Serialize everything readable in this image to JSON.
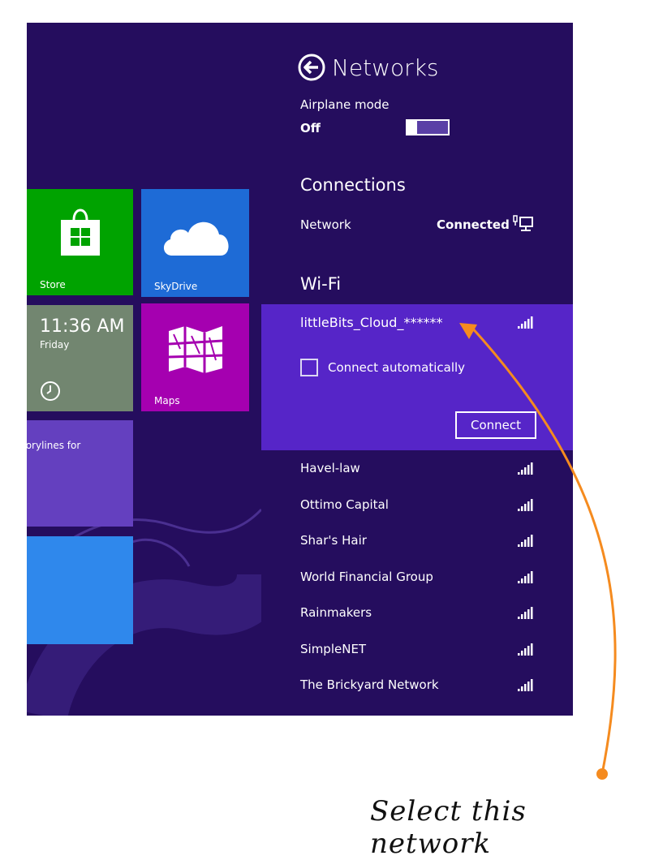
{
  "start": {
    "tiles": {
      "store": {
        "label": "Store"
      },
      "skydrive": {
        "label": "SkyDrive"
      },
      "clock": {
        "time": "11:36 AM",
        "day": "Friday"
      },
      "maps": {
        "label": "Maps"
      },
      "news": {
        "text": "torylines for"
      }
    }
  },
  "panel": {
    "title": "Networks",
    "airplane": {
      "label": "Airplane mode",
      "state": "Off"
    },
    "connections_heading": "Connections",
    "network": {
      "label": "Network",
      "status": "Connected"
    },
    "wifi_heading": "Wi-Fi",
    "selected": {
      "name": "littleBits_Cloud_******",
      "connect_auto_label": "Connect automatically",
      "connect_auto_checked": false,
      "connect_button": "Connect"
    },
    "networks": [
      {
        "name": "Havel-law"
      },
      {
        "name": "Ottimo Capital"
      },
      {
        "name": "Shar's Hair"
      },
      {
        "name": "World Financial Group"
      },
      {
        "name": "Rainmakers"
      },
      {
        "name": "SimpleNET"
      },
      {
        "name": "The Brickyard Network"
      }
    ]
  },
  "annotation": {
    "caption": "Select this network",
    "color": "#f58b1f"
  },
  "colors": {
    "background": "#250d5e",
    "selected_bg": "#5625c8",
    "store": "#00a300",
    "skydrive": "#1e6bd6",
    "maps": "#a500b0"
  }
}
